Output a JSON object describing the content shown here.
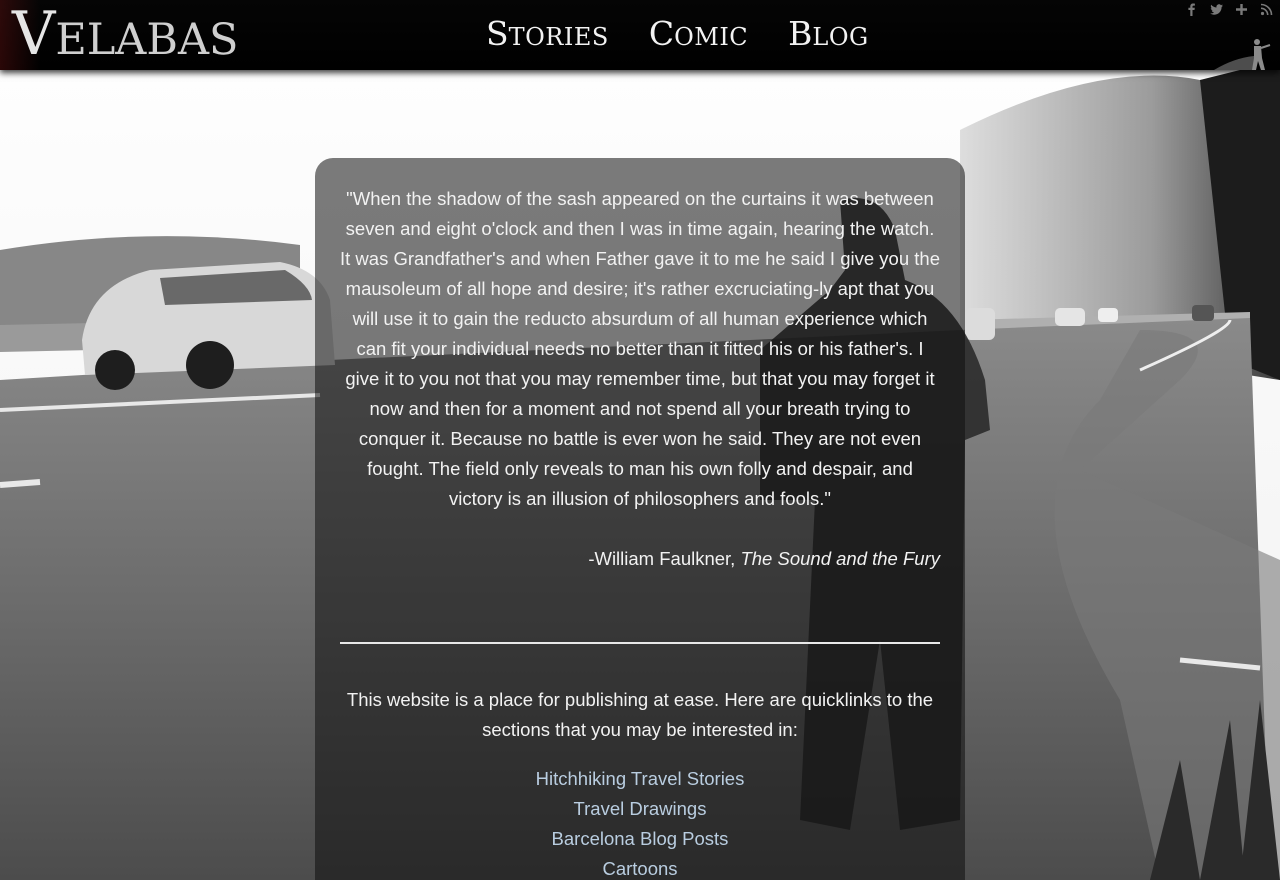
{
  "site": {
    "logo_initial": "V",
    "logo_rest": "ELABAS"
  },
  "nav": [
    {
      "cap": "S",
      "rest": "TORIES"
    },
    {
      "cap": "C",
      "rest": "OMIC"
    },
    {
      "cap": "B",
      "rest": "LOG"
    }
  ],
  "social_icons": [
    "facebook-icon",
    "twitter-icon",
    "plus-icon",
    "rss-icon"
  ],
  "quote": {
    "text": "\"When the shadow of the sash appeared on the curtains it was between seven and eight o'clock and then I was in time again, hearing the watch. It was Grandfather's and when Father gave it to me he said I give you the mausoleum of all hope and desire; it's rather excruciating-ly apt that you will use it to gain the reducto absurdum of all human experience which can fit your individual needs no better than it fitted his or his father's. I give it to you not that you may remember time, but that you may forget it now and then for a moment and not spend all your breath trying to conquer it. Because no battle is ever won he said. They are not even fought. The field only reveals to man his own folly and despair, and victory is an illusion of philosophers and fools.\"",
    "author": "-William Faulkner,",
    "work": "The Sound and the Fury"
  },
  "intro": "This website is a place for publishing at ease. Here are quicklinks to the sections that you may be interested in:",
  "quicklinks": [
    "Hitchhiking Travel Stories",
    "Travel Drawings",
    "Barcelona Blog Posts",
    "Cartoons"
  ],
  "colors": {
    "topbar": "#000000",
    "link": "#b9cde0",
    "text": "#f2f2f2"
  }
}
